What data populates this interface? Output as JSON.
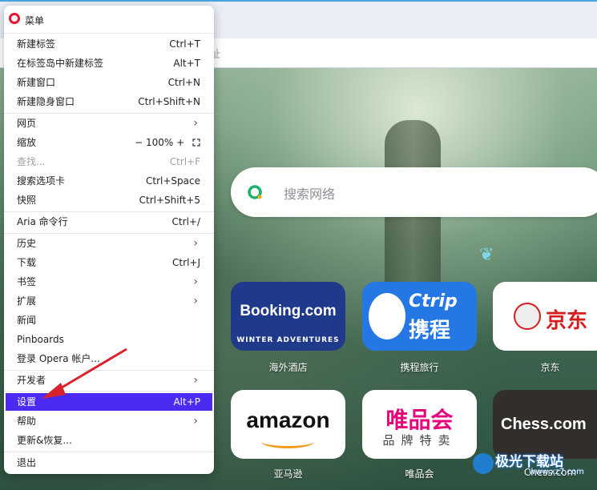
{
  "address_bar": {
    "hint": "址"
  },
  "search": {
    "placeholder": "搜索网络"
  },
  "speed_dial": [
    {
      "brand": "Booking.com",
      "sub": "WINTER ADVENTURES",
      "label": "海外酒店"
    },
    {
      "brand": "Ctrip",
      "sub": "携程",
      "label": "携程旅行"
    },
    {
      "brand": "京东",
      "label": "京东"
    },
    {
      "brand": "amazon",
      "label": "亚马逊"
    },
    {
      "brand": "唯品会",
      "sub": "品牌特卖",
      "label": "唯品会"
    },
    {
      "brand": "Chess.com",
      "label": "Chess.com"
    }
  ],
  "menu": {
    "title": "菜单",
    "items": [
      {
        "label": "新建标签",
        "shortcut": "Ctrl+T"
      },
      {
        "label": "在标签岛中新建标签",
        "shortcut": "Alt+T"
      },
      {
        "label": "新建窗口",
        "shortcut": "Ctrl+N"
      },
      {
        "label": "新建隐身窗口",
        "shortcut": "Ctrl+Shift+N"
      },
      {
        "label": "网页",
        "shortcut": ""
      },
      {
        "label": "缩放",
        "shortcut": "− 100% +"
      },
      {
        "label": "查找...",
        "shortcut": "Ctrl+F"
      },
      {
        "label": "搜索选项卡",
        "shortcut": "Ctrl+Space"
      },
      {
        "label": "快照",
        "shortcut": "Ctrl+Shift+5"
      },
      {
        "label": "Aria 命令行",
        "shortcut": "Ctrl+/"
      },
      {
        "label": "历史",
        "shortcut": ""
      },
      {
        "label": "下载",
        "shortcut": "Ctrl+J"
      },
      {
        "label": "书签",
        "shortcut": ""
      },
      {
        "label": "扩展",
        "shortcut": ""
      },
      {
        "label": "新闻",
        "shortcut": ""
      },
      {
        "label": "Pinboards",
        "shortcut": ""
      },
      {
        "label": "登录 Opera 帐户...",
        "shortcut": ""
      },
      {
        "label": "开发者",
        "shortcut": ""
      },
      {
        "label": "设置",
        "shortcut": "Alt+P"
      },
      {
        "label": "帮助",
        "shortcut": ""
      },
      {
        "label": "更新&恢复...",
        "shortcut": ""
      },
      {
        "label": "退出",
        "shortcut": ""
      }
    ]
  },
  "watermark": {
    "text": "极光下载站",
    "sub": "www.xz7.com"
  },
  "colors": {
    "selected": "#4b2bf2",
    "opera_red": "#e8162e",
    "arrow": "#d8232a"
  }
}
